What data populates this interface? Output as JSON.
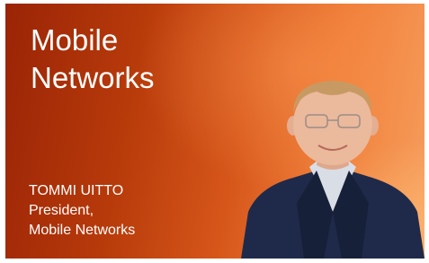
{
  "card": {
    "title_lines": [
      "Mobile",
      "Networks"
    ],
    "person": {
      "name": "TOMMI UITTO",
      "role_lines": [
        "President,",
        "Mobile Networks"
      ]
    },
    "photo_icon": "person-portrait-icon"
  },
  "colors": {
    "gradient_dark": "#9a2406",
    "gradient_mid": "#d6561a",
    "gradient_light": "#f7a060",
    "text": "#ffffff",
    "suit": "#1f2a4a",
    "shirt": "#d9dde6"
  }
}
